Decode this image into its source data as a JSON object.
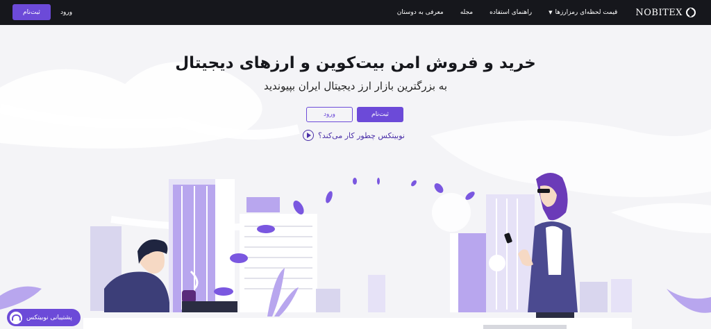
{
  "navbar": {
    "brand": "NOBITEX",
    "items": [
      {
        "label": "قیمت لحظه‌ای رمزارزها",
        "has_caret": true
      },
      {
        "label": "راهنمای استفاده"
      },
      {
        "label": "مجله"
      },
      {
        "label": "معرفی به دوستان"
      }
    ],
    "login_label": "ورود",
    "signup_label": "ثبت‌نام"
  },
  "hero": {
    "title": "خرید و فروش امن بیت‌کوین و ارزهای دیجیتال",
    "subtitle": "به بزرگترین بازار ارز دیجیتال ایران بپیوندید",
    "signup_label": "ثبت‌نام",
    "login_label": "ورود",
    "how_it_works": "نوبیتکس چطور کار می‌کند؟"
  },
  "support": {
    "label": "پشتیبانی نوبیتکس"
  },
  "colors": {
    "accent": "#6c4ad8",
    "navbar": "#16171c",
    "background": "#f4f4f7"
  },
  "icons": [
    "play-icon",
    "headset-icon",
    "caret-down-icon",
    "nobitex-logo-icon"
  ]
}
